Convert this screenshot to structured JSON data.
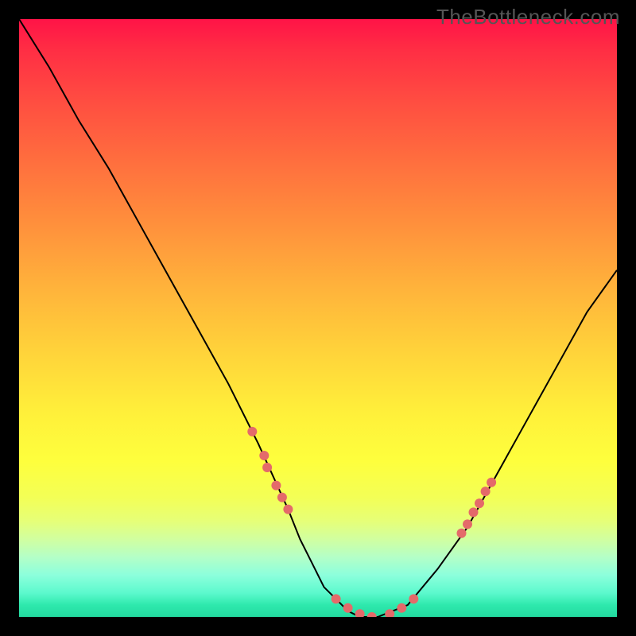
{
  "watermark": "TheBottleneck.com",
  "chart_data": {
    "type": "line",
    "title": "",
    "xlabel": "",
    "ylabel": "",
    "xlim": [
      0,
      100
    ],
    "ylim": [
      0,
      100
    ],
    "series": [
      {
        "name": "curve",
        "x": [
          0,
          5,
          10,
          15,
          20,
          25,
          30,
          35,
          40,
          45,
          47,
          49,
          51,
          53,
          55,
          57,
          60,
          65,
          70,
          75,
          80,
          85,
          90,
          95,
          100
        ],
        "y": [
          100,
          92,
          83,
          75,
          66,
          57,
          48,
          39,
          29,
          18,
          13,
          9,
          5,
          3,
          1,
          0,
          0,
          2,
          8,
          15,
          24,
          33,
          42,
          51,
          58
        ],
        "color": "#000000",
        "stroke_width": 2
      }
    ],
    "markers": {
      "color": "#e46a6a",
      "radius": 6,
      "points": [
        {
          "x": 39,
          "y": 31
        },
        {
          "x": 41,
          "y": 27
        },
        {
          "x": 41.5,
          "y": 25
        },
        {
          "x": 43,
          "y": 22
        },
        {
          "x": 44,
          "y": 20
        },
        {
          "x": 45,
          "y": 18
        },
        {
          "x": 53,
          "y": 3
        },
        {
          "x": 55,
          "y": 1.5
        },
        {
          "x": 57,
          "y": 0.5
        },
        {
          "x": 59,
          "y": 0
        },
        {
          "x": 62,
          "y": 0.5
        },
        {
          "x": 64,
          "y": 1.5
        },
        {
          "x": 66,
          "y": 3
        },
        {
          "x": 74,
          "y": 14
        },
        {
          "x": 75,
          "y": 15.5
        },
        {
          "x": 76,
          "y": 17.5
        },
        {
          "x": 77,
          "y": 19
        },
        {
          "x": 78,
          "y": 21
        },
        {
          "x": 79,
          "y": 22.5
        }
      ]
    }
  }
}
